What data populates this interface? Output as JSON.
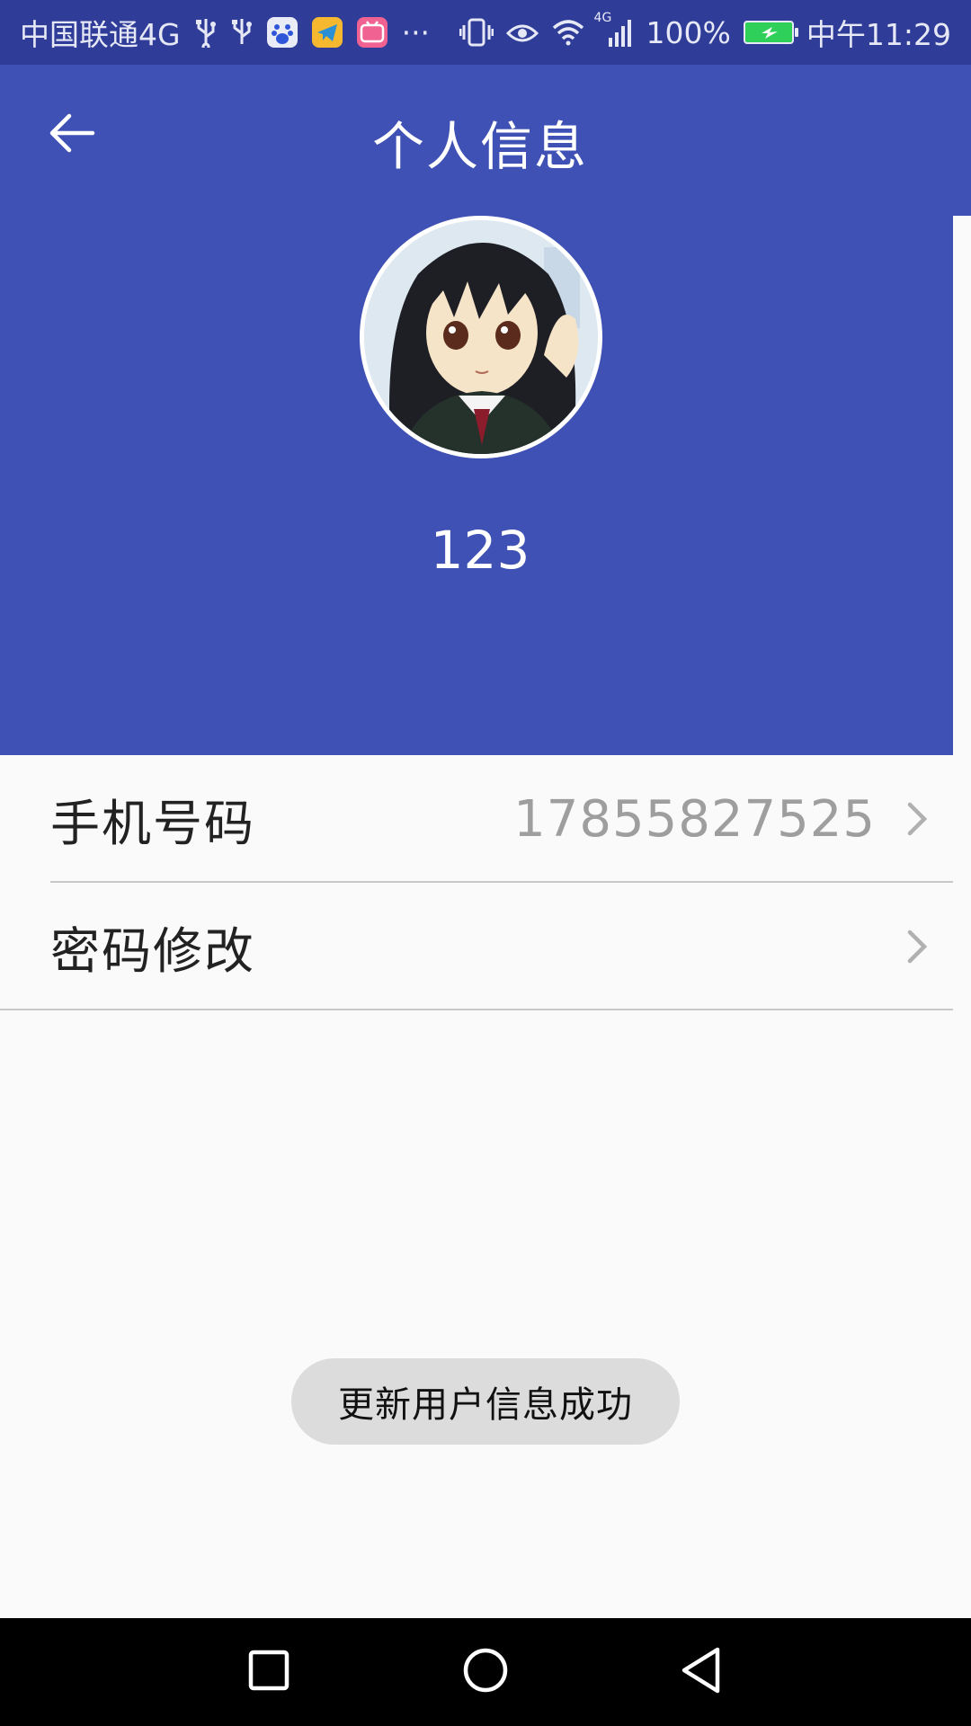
{
  "status_bar": {
    "carrier": "中国联通4G",
    "more": "···",
    "network_badge": "4G",
    "battery": "100%",
    "time": "中午11:29",
    "icons": [
      "usb-icon",
      "usb-icon",
      "baidu-app-icon",
      "telegram-app-icon",
      "bilibili-app-icon",
      "vibrate-icon",
      "eye-icon",
      "wifi-icon",
      "signal-icon",
      "battery-charging-icon"
    ]
  },
  "header": {
    "title": "个人信息",
    "back_icon": "arrow-left-icon"
  },
  "profile": {
    "username": "123",
    "avatar": "anime-avatar"
  },
  "list": [
    {
      "label": "手机号码",
      "value": "17855827525",
      "icon": "chevron-right-icon"
    },
    {
      "label": "密码修改",
      "value": "",
      "icon": "chevron-right-icon"
    }
  ],
  "toast": {
    "message": "更新用户信息成功"
  },
  "nav_bar": {
    "icons": [
      "recent-apps-icon",
      "home-icon",
      "back-triangle-icon"
    ]
  },
  "colors": {
    "primary": "#3f51b5",
    "status_bar": "#2f3d99",
    "background": "#fafafa",
    "value_text": "#9e9e9e",
    "toast_bg": "#dcdcdc"
  }
}
